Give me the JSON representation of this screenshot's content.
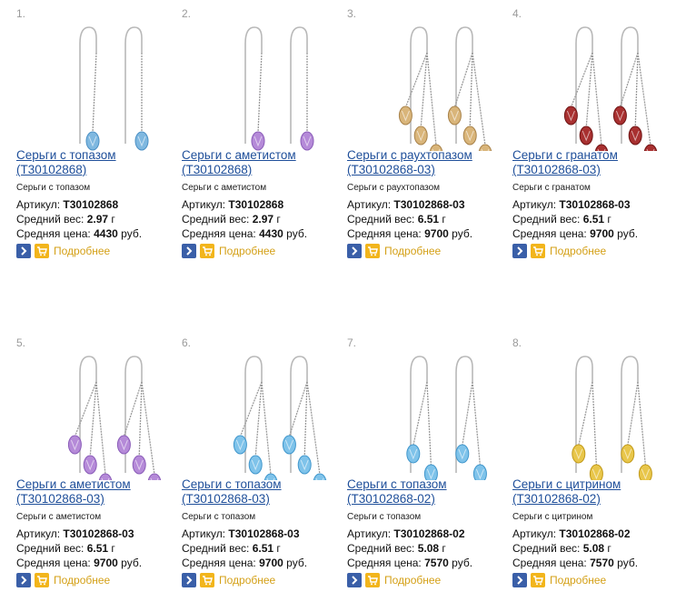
{
  "products": [
    {
      "num": "1.",
      "title": "Серьги с топазом",
      "code": "(T30102868)",
      "sub": "Серьги с топазом",
      "article_label": "Артикул:",
      "article": "T30102868",
      "weight_label": "Средний вес:",
      "weight": "2.97",
      "weight_unit": "г",
      "price_label": "Средняя цена:",
      "price": "4430",
      "currency": "руб.",
      "more": "Подробнее",
      "gem_color": "#7fb8e0",
      "gem_dark": "#4a8fc4",
      "drops": 1
    },
    {
      "num": "2.",
      "title": "Серьги с аметистом",
      "code": "(T30102868)",
      "sub": "Серьги с аметистом",
      "article_label": "Артикул:",
      "article": "T30102868",
      "weight_label": "Средний вес:",
      "weight": "2.97",
      "weight_unit": "г",
      "price_label": "Средняя цена:",
      "price": "4430",
      "currency": "руб.",
      "more": "Подробнее",
      "gem_color": "#b58ad8",
      "gem_dark": "#8a5cb8",
      "drops": 1
    },
    {
      "num": "3.",
      "title": "Серьги с раухтопазом",
      "code": "(T30102868-03)",
      "sub": "Серьги с раухтопазом",
      "article_label": "Артикул:",
      "article": "T30102868-03",
      "weight_label": "Средний вес:",
      "weight": "6.51",
      "weight_unit": "г",
      "price_label": "Средняя цена:",
      "price": "9700",
      "currency": "руб.",
      "more": "Подробнее",
      "gem_color": "#d9b57a",
      "gem_dark": "#a8824a",
      "drops": 3
    },
    {
      "num": "4.",
      "title": "Серьги с гранатом",
      "code": "(T30102868-03)",
      "sub": "Серьги с гранатом",
      "article_label": "Артикул:",
      "article": "T30102868-03",
      "weight_label": "Средний вес:",
      "weight": "6.51",
      "weight_unit": "г",
      "price_label": "Средняя цена:",
      "price": "9700",
      "currency": "руб.",
      "more": "Подробнее",
      "gem_color": "#a83030",
      "gem_dark": "#6e1414",
      "drops": 3
    },
    {
      "num": "5.",
      "title": "Серьги с аметистом",
      "code": "(T30102868-03)",
      "sub": "Серьги с аметистом",
      "article_label": "Артикул:",
      "article": "T30102868-03",
      "weight_label": "Средний вес:",
      "weight": "6.51",
      "weight_unit": "г",
      "price_label": "Средняя цена:",
      "price": "9700",
      "currency": "руб.",
      "more": "Подробнее",
      "gem_color": "#b58ad8",
      "gem_dark": "#8a5cb8",
      "drops": 3
    },
    {
      "num": "6.",
      "title": "Серьги с топазом",
      "code": "(T30102868-03)",
      "sub": "Серьги с топазом",
      "article_label": "Артикул:",
      "article": "T30102868-03",
      "weight_label": "Средний вес:",
      "weight": "6.51",
      "weight_unit": "г",
      "price_label": "Средняя цена:",
      "price": "9700",
      "currency": "руб.",
      "more": "Подробнее",
      "gem_color": "#7fc3ea",
      "gem_dark": "#3f96cc",
      "drops": 3
    },
    {
      "num": "7.",
      "title": "Серьги с топазом",
      "code": "(T30102868-02)",
      "sub": "Серьги с топазом",
      "article_label": "Артикул:",
      "article": "T30102868-02",
      "weight_label": "Средний вес:",
      "weight": "5.08",
      "weight_unit": "г",
      "price_label": "Средняя цена:",
      "price": "7570",
      "currency": "руб.",
      "more": "Подробнее",
      "gem_color": "#7fc3ea",
      "gem_dark": "#3f96cc",
      "drops": 2
    },
    {
      "num": "8.",
      "title": "Серьги с цитрином",
      "code": "(T30102868-02)",
      "sub": "Серьги с цитрином",
      "article_label": "Артикул:",
      "article": "T30102868-02",
      "weight_label": "Средний вес:",
      "weight": "5.08",
      "weight_unit": "г",
      "price_label": "Средняя цена:",
      "price": "7570",
      "currency": "руб.",
      "more": "Подробнее",
      "gem_color": "#e8c64a",
      "gem_dark": "#c29a1a",
      "drops": 2
    }
  ]
}
